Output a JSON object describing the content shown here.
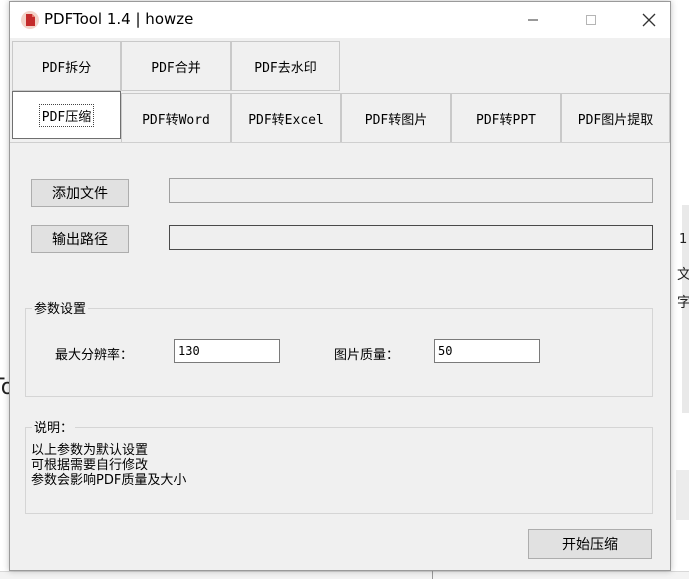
{
  "window": {
    "title": "PDFTool 1.4 |  howze",
    "controls": {
      "minimize": "—",
      "maximize": "☐",
      "close": "✕"
    }
  },
  "tabs_row1": [
    {
      "label": "PDF拆分"
    },
    {
      "label": "PDF合并"
    },
    {
      "label": "PDF去水印"
    }
  ],
  "tabs_row2": [
    {
      "label": "PDF压缩",
      "active": true
    },
    {
      "label": "PDF转Word"
    },
    {
      "label": "PDF转Excel"
    },
    {
      "label": "PDF转图片"
    },
    {
      "label": "PDF转PPT"
    },
    {
      "label": "PDF图片提取"
    }
  ],
  "compress": {
    "add_file_label": "添加文件",
    "add_file_value": "",
    "output_path_label": "输出路径",
    "output_path_value": "",
    "params": {
      "title": "参数设置",
      "max_resolution_label": "最大分辨率：",
      "max_resolution_value": "130",
      "image_quality_label": "图片质量：",
      "image_quality_value": "50"
    },
    "notes": {
      "title": "说明：",
      "lines": [
        "以上参数为默认设置",
        "可根据需要自行修改",
        "参数会影响PDF质量及大小"
      ]
    },
    "start_button_label": "开始压缩"
  },
  "background": {
    "left_fragment": "To",
    "right_fragments": [
      "1",
      "文",
      "字"
    ]
  },
  "colors": {
    "window_bg": "#f0f0f0",
    "button_bg": "#e1e1e1",
    "icon_red": "#c42b2b"
  }
}
